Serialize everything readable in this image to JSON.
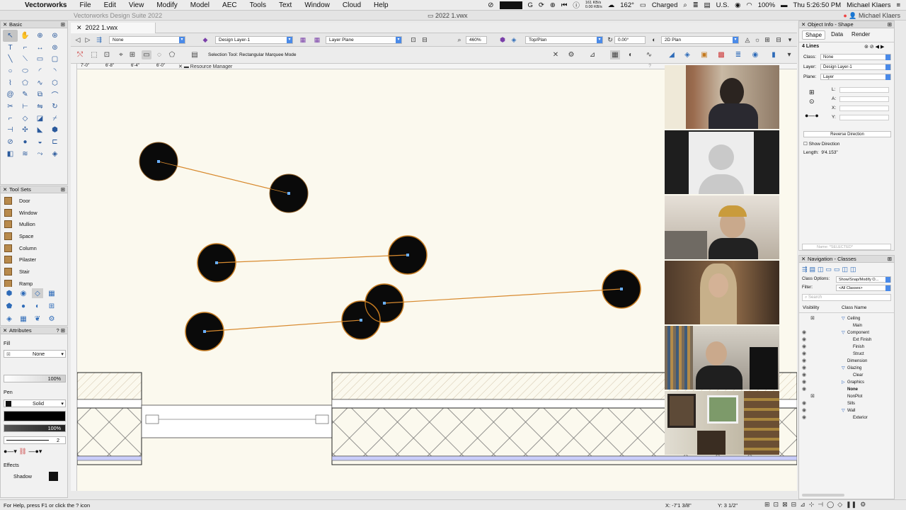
{
  "menubar": {
    "app_name": "Vectorworks",
    "items": [
      "File",
      "Edit",
      "View",
      "Modify",
      "Model",
      "AEC",
      "Tools",
      "Text",
      "Window",
      "Cloud",
      "Help"
    ],
    "network_up": "161 KB/s",
    "network_down": "0.00 KB/s",
    "heading": "162°",
    "battery_status": "Charged",
    "locale": "U.S.",
    "battery_percent": "100%",
    "clock": "Thu 5:26:50 PM",
    "user": "Michael Klaers"
  },
  "titlebar": {
    "app_suite": "Vectorworks Design Suite 2022",
    "document": "2022 1.vwx",
    "user": "Michael Klaers"
  },
  "document_tab": {
    "label": "2022 1.vwx"
  },
  "viewbar": {
    "class_dropdown": "None",
    "layer_dropdown": "Design Layer-1",
    "plane_dropdown": "Layer Plane",
    "zoom": "460%",
    "view_dropdown": "Top/Plan",
    "rotation": "0.00°",
    "render_dropdown": "2D Plan"
  },
  "modebar": {
    "mode_text": "Selection Tool: Rectangular Marquee Mode"
  },
  "ruler": {
    "labels": [
      "7'-0\"",
      "6'-8\"",
      "6'-4\"",
      "6'-0\""
    ]
  },
  "resource_manager": {
    "title": "Resource Manager"
  },
  "basic_palette": {
    "title": "Basic",
    "tools": [
      "arrow-icon",
      "pan-icon",
      "flyover-icon",
      "walkthrough-icon",
      "text-icon",
      "callout-icon",
      "dimension-icon",
      "constraint-icon",
      "line-icon",
      "double-line-icon",
      "rectangle-icon",
      "rounded-rectangle-icon",
      "circle-icon",
      "oval-icon",
      "arc-icon",
      "quarter-arc-icon",
      "polyline-icon",
      "polygon-icon",
      "freehand-icon",
      "regular-polygon-icon",
      "spiral-icon",
      "eyedropper-icon",
      "offset-icon",
      "fillet-icon",
      "knife-icon",
      "trim-icon",
      "mirror-icon",
      "rotate-icon",
      "connect-icon",
      "reshape-icon",
      "clip-icon",
      "split-icon",
      "extend-icon",
      "move-icon",
      "chamfer-icon",
      "symbol-icon",
      "hatch-icon",
      "loci-icon",
      "stake-icon",
      "hypertext-icon",
      "camera-icon",
      "stair-icon",
      "curve-icon",
      "snap-icon"
    ]
  },
  "tool_sets": {
    "title": "Tool Sets",
    "items": [
      {
        "label": "Door"
      },
      {
        "label": "Window"
      },
      {
        "label": "Mullion"
      },
      {
        "label": "Space"
      },
      {
        "label": "Column"
      },
      {
        "label": "Pilaster"
      },
      {
        "label": "Stair"
      },
      {
        "label": "Ramp"
      }
    ],
    "set_icons": [
      "building-shell-icon",
      "site-icon",
      "detail-icon",
      "furniture-icon",
      "landscape-icon",
      "lighting-icon",
      "spotlight-icon",
      "dimension-set-icon",
      "visualization-icon",
      "machine-icon",
      "plant-icon",
      "settings-icon"
    ]
  },
  "attributes": {
    "title": "Attributes",
    "fill_label": "Fill",
    "fill_style": "None",
    "fill_opacity": "100%",
    "pen_label": "Pen",
    "pen_style": "Solid",
    "pen_opacity": "100%",
    "line_weight": "2",
    "effects_label": "Effects",
    "shadow_label": "Shadow"
  },
  "object_info": {
    "title": "Object Info - Shape",
    "tabs": [
      "Shape",
      "Data",
      "Render"
    ],
    "selection": "4 Lines",
    "class_label": "Class:",
    "class_value": "None",
    "layer_label": "Layer:",
    "layer_value": "Design Layer-1",
    "plane_label": "Plane:",
    "plane_value": "Layer",
    "fields": [
      "L:",
      "A:",
      "X:",
      "Y:"
    ],
    "reverse_button": "Reverse Direction",
    "show_direction": "Show Direction",
    "length_label": "Length:",
    "length_value": "9'4.153\"",
    "name_placeholder": "Name: *SELECTED*"
  },
  "navigation": {
    "title": "Navigation - Classes",
    "class_options_label": "Class Options:",
    "class_options_value": "Show/Snap/Modify O...",
    "filter_label": "Filter:",
    "filter_value": "<All Classes>",
    "search_placeholder": "Search",
    "col_visibility": "Visibility",
    "col_classname": "Class Name",
    "rows": [
      {
        "name": "Ceiling",
        "indent": 0,
        "tri": "▽",
        "vis": "x"
      },
      {
        "name": "Main",
        "indent": 1,
        "tri": "",
        "vis": ""
      },
      {
        "name": "Component",
        "indent": 0,
        "tri": "▽",
        "vis": "eye"
      },
      {
        "name": "Ext Finish",
        "indent": 1,
        "tri": "",
        "vis": "eye"
      },
      {
        "name": "Finish",
        "indent": 1,
        "tri": "",
        "vis": "eye"
      },
      {
        "name": "Struct",
        "indent": 1,
        "tri": "",
        "vis": "eye"
      },
      {
        "name": "Dimension",
        "indent": 0,
        "tri": "",
        "vis": "eye"
      },
      {
        "name": "Glazing",
        "indent": 0,
        "tri": "▽",
        "vis": "eye"
      },
      {
        "name": "Clear",
        "indent": 1,
        "tri": "",
        "vis": "eye"
      },
      {
        "name": "Graphics",
        "indent": 0,
        "tri": "▷",
        "vis": "eye"
      },
      {
        "name": "None",
        "indent": 0,
        "tri": "",
        "vis": "eye"
      },
      {
        "name": "NonPlot",
        "indent": 0,
        "tri": "",
        "vis": "x"
      },
      {
        "name": "Sills",
        "indent": 0,
        "tri": "",
        "vis": "eye"
      },
      {
        "name": "Wall",
        "indent": 0,
        "tri": "▽",
        "vis": "eye"
      },
      {
        "name": "Exterior",
        "indent": 1,
        "tri": "",
        "vis": "eye"
      }
    ]
  },
  "status": {
    "help_text": "For Help, press F1 or click the ? icon",
    "x_coord": "X: -7'1 3/8\"",
    "y_coord": "Y: 3 1/2\""
  },
  "colors": {
    "accent": "#4a8ae8",
    "canvas_bg": "#fbf9ee",
    "line_orange": "#d88a2f",
    "node_fill": "#0a0a0a"
  }
}
